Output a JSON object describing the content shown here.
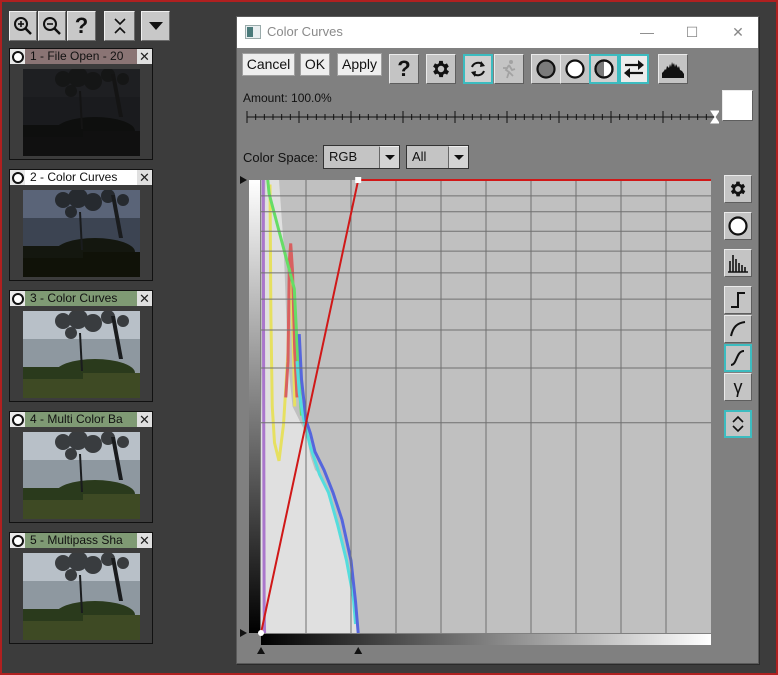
{
  "left_toolbar": {
    "buttons": [
      {
        "name": "zoom-in",
        "icon": "zoom-in-icon"
      },
      {
        "name": "zoom-out",
        "icon": "zoom-out-icon"
      },
      {
        "name": "help",
        "icon": "help-icon",
        "label": "?"
      },
      {
        "name": "collapse",
        "icon": "collapse-icon"
      },
      {
        "name": "menu",
        "icon": "dropdown-icon"
      }
    ]
  },
  "history": [
    {
      "label": "1 - File Open - 20",
      "header_color": "#8a7474",
      "thumb": "dark"
    },
    {
      "label": "2 - Color Curves",
      "header_color": "#ffffff",
      "thumb": "mid"
    },
    {
      "label": "3 - Color Curves",
      "header_color": "#7f9a74",
      "thumb": "bright"
    },
    {
      "label": "4 - Multi Color Ba",
      "header_color": "#7f9a74",
      "thumb": "bright"
    },
    {
      "label": "5 - Multipass Sha",
      "header_color": "#7f9a74",
      "thumb": "bright"
    }
  ],
  "history_close_glyph": "✕",
  "dialog": {
    "title": "Color Curves",
    "window_controls": {
      "minimize": "—",
      "maximize": "☐",
      "close": "✕"
    },
    "buttons": {
      "cancel": "Cancel",
      "ok": "OK",
      "apply": "Apply",
      "help": "?"
    },
    "toggles": {
      "live_preview": true,
      "run": false,
      "gray_circle": false,
      "white_circle": false,
      "half_circle": true,
      "swap": true
    },
    "amount_label": "Amount: 100.0%",
    "amount_value_percent": 100,
    "color_space_label": "Color Space:",
    "color_space": "RGB",
    "channel": "All",
    "accent_color": "#3cbcc0",
    "curve_color": "#d01818",
    "side_buttons": [
      {
        "name": "settings",
        "icon": "gear-icon",
        "active": false
      },
      {
        "name": "circle",
        "icon": "circle-icon",
        "active": false
      },
      {
        "name": "histogram",
        "icon": "histogram-icon",
        "active": false
      },
      {
        "name": "step-curve",
        "icon": "step-curve-icon",
        "active": false
      },
      {
        "name": "log-curve",
        "icon": "log-curve-icon",
        "active": false
      },
      {
        "name": "s-curve",
        "icon": "s-curve-icon",
        "active": true
      },
      {
        "name": "gamma",
        "icon": "gamma-icon",
        "label": "γ",
        "active": false
      },
      {
        "name": "expand",
        "icon": "expand-icon",
        "active": true
      }
    ],
    "curve": {
      "points": [
        [
          0,
          0
        ],
        [
          0.216,
          1
        ],
        [
          1,
          1
        ]
      ],
      "input_black_marker": 0,
      "input_white_marker": 0.216
    }
  }
}
